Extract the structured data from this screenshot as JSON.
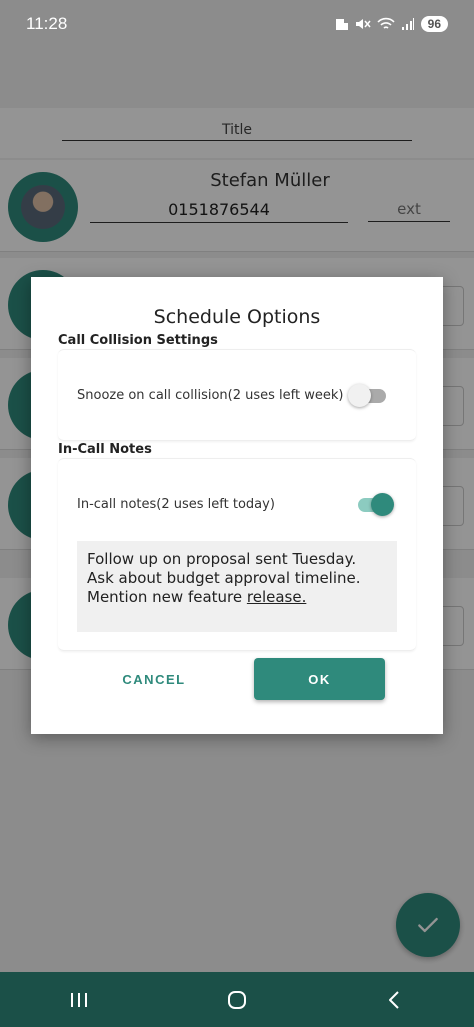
{
  "status_bar": {
    "time": "11:28",
    "battery": "96"
  },
  "background": {
    "title_placeholder": "Title",
    "contact": {
      "name": "Stefan Müller",
      "phone": "0151876544",
      "ext_placeholder": "ext"
    }
  },
  "dialog": {
    "title": "Schedule Options",
    "call_collision": {
      "header": "Call Collision Settings",
      "snooze_label": "Snooze on call collision(2 uses left week)",
      "snooze_enabled": false
    },
    "in_call_notes": {
      "header": "In-Call Notes",
      "notes_label": "In-call notes(2 uses left today)",
      "notes_enabled": true,
      "notes_text": "Follow up on proposal sent Tuesday. Ask about budget approval timeline. Mention new feature",
      "notes_text_underlined": "release."
    },
    "cancel_label": "CANCEL",
    "ok_label": "OK"
  },
  "colors": {
    "accent": "#2f8a7c",
    "nav_bar": "#1b5048"
  }
}
